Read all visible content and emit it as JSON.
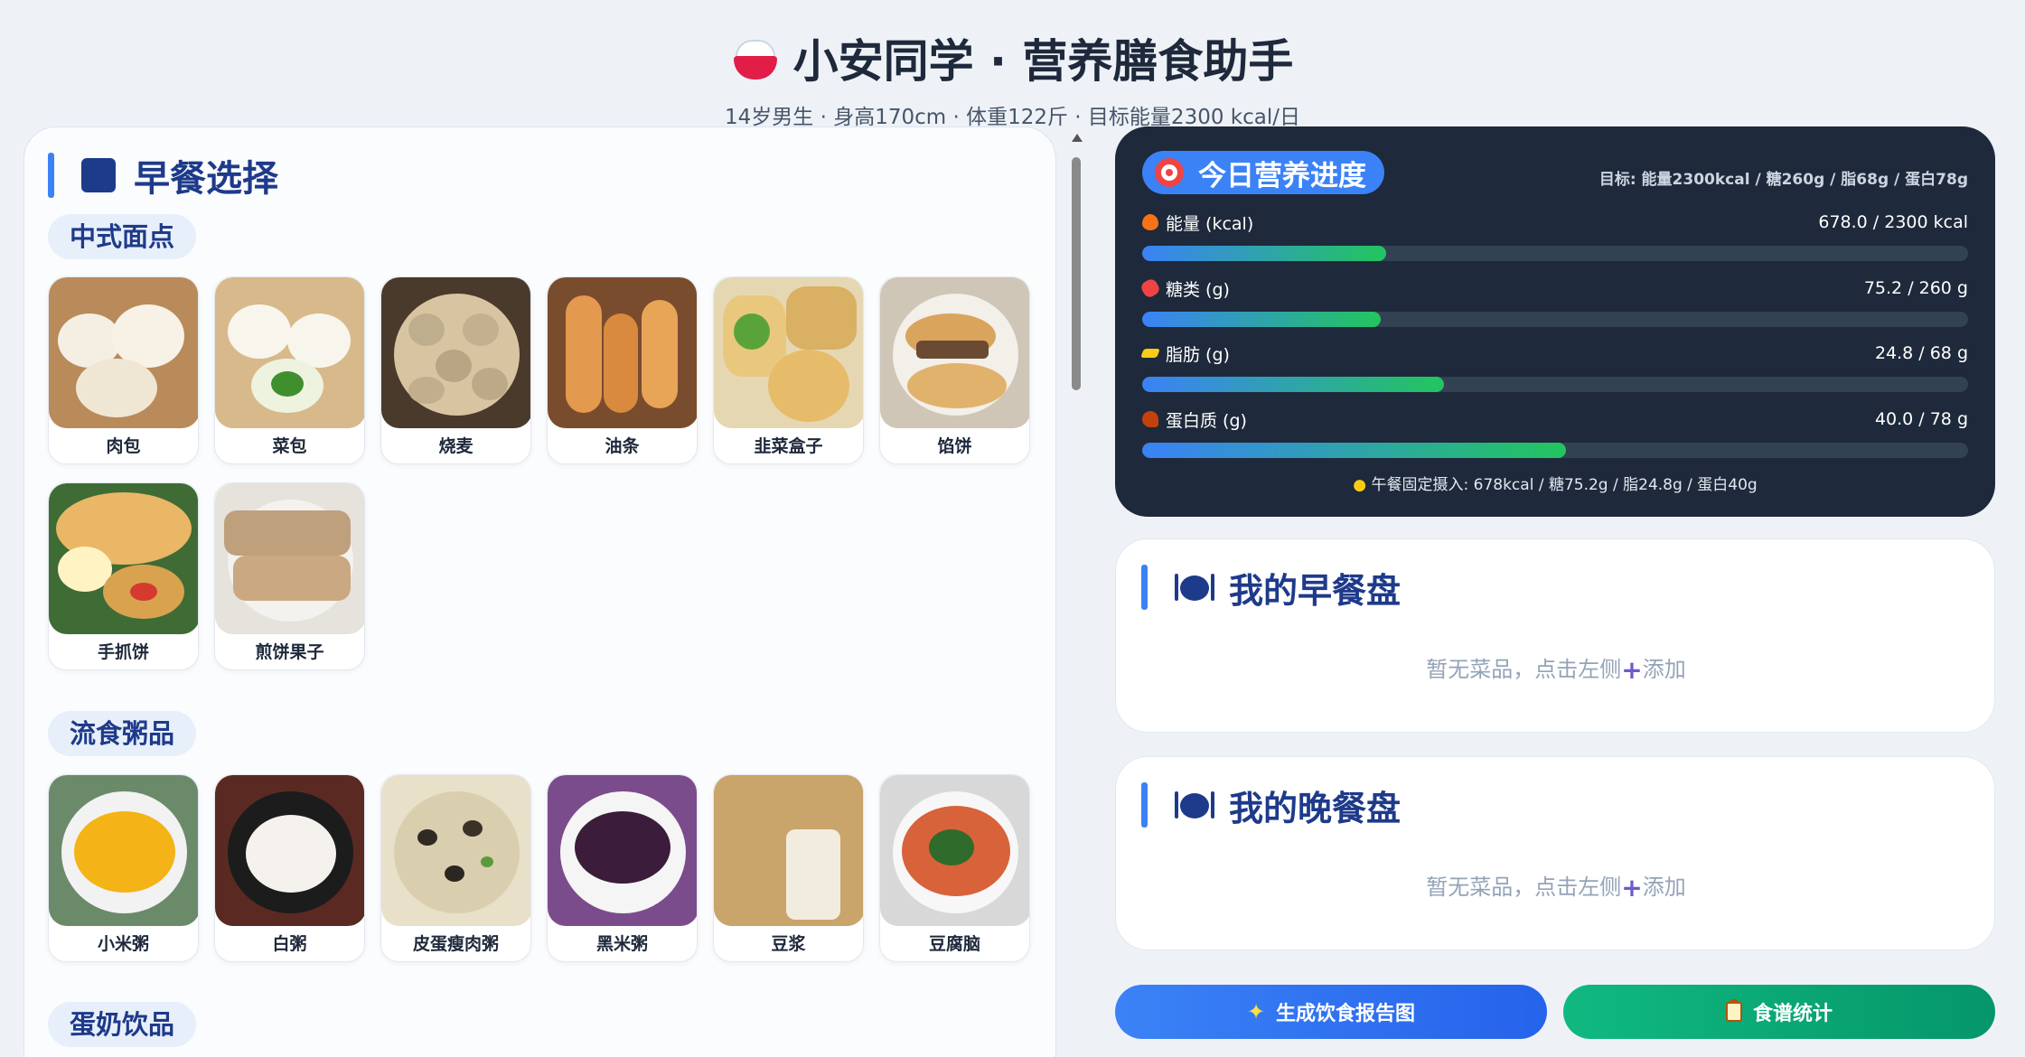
{
  "header": {
    "title": "小安同学 · 营养膳食助手",
    "subtitle": "14岁男生 · 身高170cm · 体重122斤 · 目标能量2300 kcal/日",
    "icon": "rice-bowl-icon"
  },
  "left": {
    "title": "早餐选择",
    "categories": [
      {
        "label": "中式面点",
        "items": [
          "肉包",
          "菜包",
          "烧麦",
          "油条",
          "韭菜盒子",
          "馅饼",
          "手抓饼",
          "煎饼果子"
        ]
      },
      {
        "label": "流食粥品",
        "items": [
          "小米粥",
          "白粥",
          "皮蛋瘦肉粥",
          "黑米粥",
          "豆浆",
          "豆腐脑"
        ]
      },
      {
        "label": "蛋奶饮品",
        "items": []
      }
    ]
  },
  "progress": {
    "title": "今日营养进度",
    "goal": "目标: 能量2300kcal / 糖260g / 脂68g / 蛋白78g",
    "nutrients": [
      {
        "name": "能量 (kcal)",
        "value_text": "678.0 / 2300 kcal",
        "fraction": 0.295,
        "icon": "fire-icon"
      },
      {
        "name": "糖类 (g)",
        "value_text": "75.2 / 260 g",
        "fraction": 0.289,
        "icon": "candy-icon"
      },
      {
        "name": "脂肪 (g)",
        "value_text": "24.8 / 68 g",
        "fraction": 0.365,
        "icon": "butter-icon"
      },
      {
        "name": "蛋白质 (g)",
        "value_text": "40.0 / 78 g",
        "fraction": 0.513,
        "icon": "drumstick-icon"
      }
    ],
    "lunch_note": "午餐固定摄入: 678kcal / 糖75.2g / 脂24.8g / 蛋白40g"
  },
  "breakfast_plate": {
    "title": "我的早餐盘",
    "empty_before": "暂无菜品，点击左侧",
    "empty_after": "添加"
  },
  "dinner_plate": {
    "title": "我的晚餐盘",
    "empty_before": "暂无菜品，点击左侧",
    "empty_after": "添加"
  },
  "buttons": {
    "report": "生成饮食报告图",
    "stats": "食谱统计"
  }
}
